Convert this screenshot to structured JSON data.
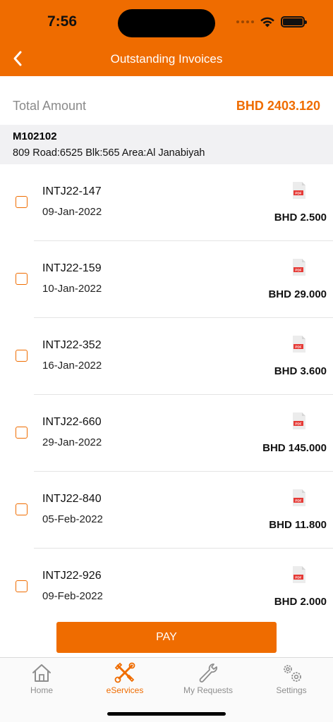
{
  "status_bar": {
    "time": "7:56"
  },
  "header": {
    "title": "Outstanding Invoices",
    "back_icon": "chevron-left-icon"
  },
  "summary": {
    "total_label": "Total Amount",
    "total_value": "BHD 2403.120"
  },
  "account": {
    "id": "M102102",
    "address": "809 Road:6525 Blk:565 Area:Al Janabiyah"
  },
  "invoices": [
    {
      "number": "INTJ22-147",
      "date": "09-Jan-2022",
      "amount": "BHD 2.500",
      "pdf_label": "PDF"
    },
    {
      "number": "INTJ22-159",
      "date": "10-Jan-2022",
      "amount": "BHD 29.000",
      "pdf_label": "PDF"
    },
    {
      "number": "INTJ22-352",
      "date": "16-Jan-2022",
      "amount": "BHD 3.600",
      "pdf_label": "PDF"
    },
    {
      "number": "INTJ22-660",
      "date": "29-Jan-2022",
      "amount": "BHD 145.000",
      "pdf_label": "PDF"
    },
    {
      "number": "INTJ22-840",
      "date": "05-Feb-2022",
      "amount": "BHD 11.800",
      "pdf_label": "PDF"
    },
    {
      "number": "INTJ22-926",
      "date": "09-Feb-2022",
      "amount": "BHD 2.000",
      "pdf_label": "PDF"
    }
  ],
  "pay_button": {
    "label": "PAY"
  },
  "tabbar": {
    "active": "eServices",
    "tabs": [
      {
        "label": "Home",
        "icon": "home-icon"
      },
      {
        "label": "eServices",
        "icon": "tools-icon"
      },
      {
        "label": "My Requests",
        "icon": "wrench-icon"
      },
      {
        "label": "Settings",
        "icon": "gears-icon"
      }
    ]
  },
  "colors": {
    "accent": "#ef6c00",
    "inactive_tab": "#8e8e8e",
    "account_bg": "#f1f1f3"
  }
}
